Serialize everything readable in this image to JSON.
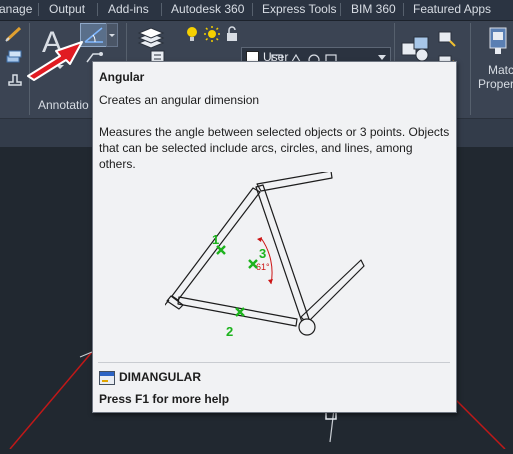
{
  "tabs": [
    "anage",
    "Output",
    "Add-ins",
    "Autodesk 360",
    "Express Tools",
    "BIM 360",
    "Featured Apps"
  ],
  "ribbon": {
    "annotation_panel_label": "Annotatio",
    "match_properties_label_1": "Matc",
    "match_properties_label_2": "Proper",
    "text_glyph": "A"
  },
  "layer": {
    "current_name": "User",
    "swatch_color": "#ffffff"
  },
  "tooltip": {
    "title": "Angular",
    "subtitle": "Creates an angular dimension",
    "description": "Measures the angle between selected objects or 3 points. Objects that can be selected include arcs, circles, and lines, among others.",
    "command": "DIMANGULAR",
    "help": "Press F1 for more help",
    "diagram": {
      "markers": [
        "1",
        "3",
        "2"
      ],
      "angle_label": "61°",
      "marker_color": "#1db31d",
      "angle_color": "#cc1414"
    }
  },
  "pointer_arrow_color": "#e11b22"
}
